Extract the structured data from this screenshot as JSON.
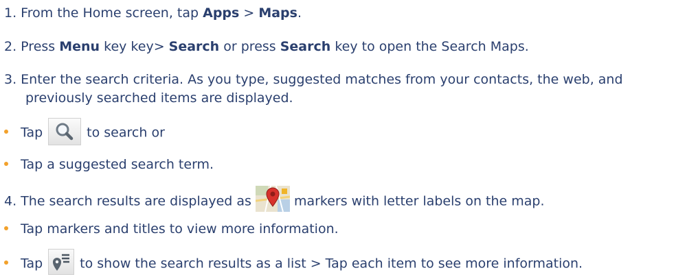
{
  "steps": {
    "s1": {
      "num": "1.",
      "pre": " From the Home screen, tap ",
      "b1": "Apps",
      "mid": " > ",
      "b2": "Maps",
      "post": "."
    },
    "s2": {
      "num": "2.",
      "pre": " Press ",
      "b1": "Menu",
      "mid1": " key key> ",
      "b2": "Search",
      "mid2": " or press ",
      "b3": "Search",
      "post": " key to open the Search Maps."
    },
    "s3": {
      "line1": "3. Enter the search criteria. As you type, suggested matches from your contacts, the web, and",
      "line2": "previously searched items are displayed."
    },
    "s3_bullets": {
      "b1_pre": "Tap",
      "b1_post": "to search or",
      "b2": "Tap a suggested search term."
    },
    "s4": {
      "pre": "4. The search results are displayed as",
      "post": "markers with letter labels on the map."
    },
    "s4_bullets": {
      "b1": "Tap markers and titles to view more information.",
      "b2_pre": "Tap",
      "b2_post": "to show the search results as a list > Tap each item to see more information."
    }
  },
  "icons": {
    "search": "search-icon",
    "marker": "map-marker-icon",
    "list": "results-list-icon"
  },
  "colors": {
    "text": "#2a3f6e",
    "bullet": "#f2a12c",
    "marker_red": "#d7322c"
  }
}
